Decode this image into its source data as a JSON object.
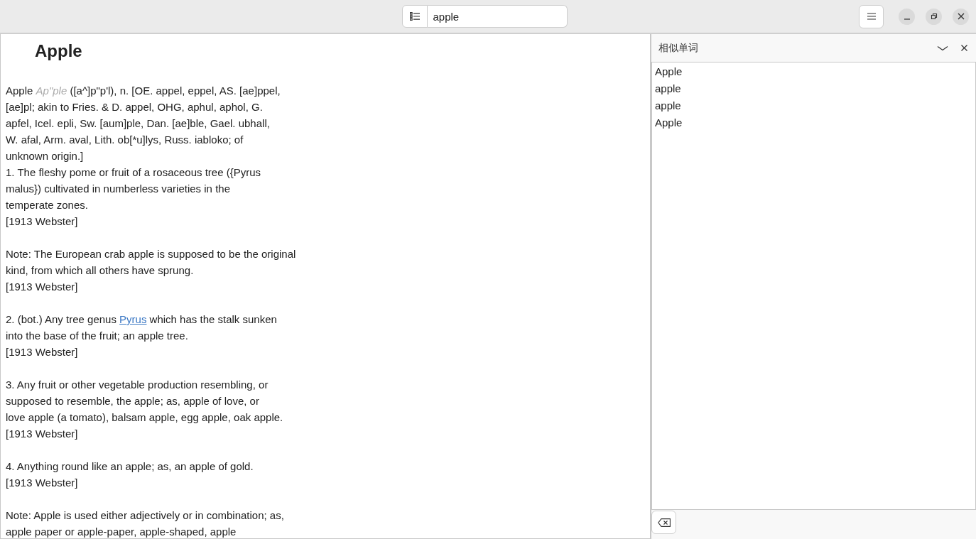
{
  "header_bar": {
    "search": {
      "value": "apple"
    }
  },
  "entry": {
    "title": "Apple",
    "paragraphs": [
      {
        "segments": [
          {
            "kind": "text",
            "text": "Apple "
          },
          {
            "kind": "pron",
            "text": "Ap\"ple"
          },
          {
            "kind": "text",
            "text": " ([a^]p\"p'l), n. [OE. appel, eppel, AS. [ae]ppel,\n[ae]pl; akin to Fries. & D. appel, OHG, aphul, aphol, G.\napfel, Icel. epli, Sw. [aum]ple, Dan. [ae]ble, Gael. ubhall,\nW. afal, Arm. aval, Lith. ob[*u]lys, Russ. iabloko; of\nunknown origin.]\n1. The fleshy pome or fruit of a rosaceous tree ({Pyrus\nmalus}) cultivated in numberless varieties in the\ntemperate zones.\n[1913 Webster]"
          }
        ]
      },
      {
        "segments": [
          {
            "kind": "text",
            "text": "Note: The European crab apple is supposed to be the original\nkind, from which all others have sprung.\n[1913 Webster]"
          }
        ]
      },
      {
        "segments": [
          {
            "kind": "text",
            "text": "2. (bot.) Any tree genus "
          },
          {
            "kind": "link",
            "text": "Pyrus"
          },
          {
            "kind": "text",
            "text": " which has the stalk sunken\ninto the base of the fruit; an apple tree.\n[1913 Webster]"
          }
        ]
      },
      {
        "segments": [
          {
            "kind": "text",
            "text": "3. Any fruit or other vegetable production resembling, or\nsupposed to resemble, the apple; as, apple of love, or\nlove apple (a tomato), balsam apple, egg apple, oak apple.\n[1913 Webster]"
          }
        ]
      },
      {
        "segments": [
          {
            "kind": "text",
            "text": "4. Anything round like an apple; as, an apple of gold.\n[1913 Webster]"
          }
        ]
      },
      {
        "segments": [
          {
            "kind": "text",
            "text": "Note: Apple is used either adjectively or in combination; as,\napple paper or apple-paper, apple-shaped, apple"
          }
        ]
      }
    ]
  },
  "similar_words": {
    "title": "相似单词",
    "items": [
      "Apple",
      "apple",
      "apple",
      "Apple"
    ]
  }
}
